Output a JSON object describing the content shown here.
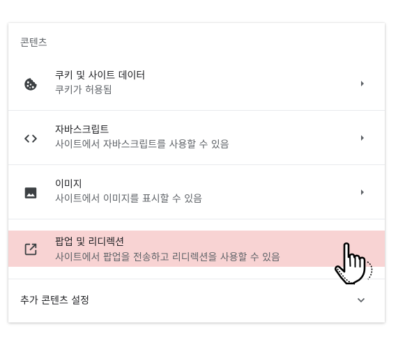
{
  "section_title": "콘텐츠",
  "rows": [
    {
      "icon": "cookie-icon",
      "title": "쿠키 및 사이트 데이터",
      "subtitle": "쿠키가 허용됨"
    },
    {
      "icon": "code-icon",
      "title": "자바스크립트",
      "subtitle": "사이트에서 자바스크립트를 사용할 수 있음"
    },
    {
      "icon": "image-icon",
      "title": "이미지",
      "subtitle": "사이트에서 이미지를 표시할 수 있음"
    },
    {
      "icon": "open-in-new-icon",
      "title": "팝업 및 리디렉션",
      "subtitle": "사이트에서 팝업을 전송하고 리디렉션을 사용할 수 있음"
    }
  ],
  "more_settings": "추가 콘텐츠 설정",
  "colors": {
    "highlight": "#f8d3d3",
    "icon": "#5f6368",
    "title": "#202124",
    "subtitle": "#5f6368"
  }
}
